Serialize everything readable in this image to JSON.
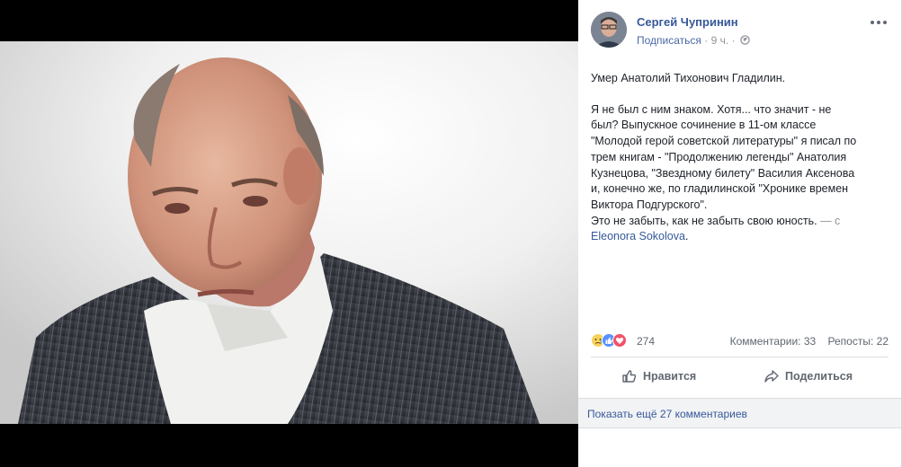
{
  "post": {
    "author": "Сергей Чупринин",
    "follow_label": "Подписаться",
    "time": "9 ч.",
    "dot": "·",
    "privacy_icon": "globe-icon",
    "paragraphs": [
      "Умер Анатолий Тихонович Гладилин.",
      "Я не был с ним знаком. Хотя... что значит - не был? Выпускное сочинение в 11-ом классе \"Молодой герой советской литературы\" я писал по трем книгам - \"Продолжению легенды\" Анатолия Кузнецова, \"Звездному билету\" Василия Аксенова и, конечно же, по гладилинской \"Хронике времен Виктора Подгурского\"."
    ],
    "last_line": "Это не забыть, как не забыть свою юность.",
    "with_prefix": "— с",
    "tagged_person": "Eleonora Sokolova",
    "tag_suffix": "."
  },
  "reactions": {
    "icons": [
      "sad-reaction-icon",
      "like-reaction-icon",
      "love-reaction-icon"
    ],
    "count": "274",
    "comments": "Комментарии: 33",
    "shares": "Репосты: 22"
  },
  "actions": {
    "like_label": "Нравится",
    "share_label": "Поделиться"
  },
  "more_comments": "Показать ещё 27 комментариев",
  "colors": {
    "link": "#365899",
    "text": "#1d2129",
    "muted": "#90949c",
    "panel_bg": "#ffffff",
    "viewer_bg": "#000000"
  }
}
